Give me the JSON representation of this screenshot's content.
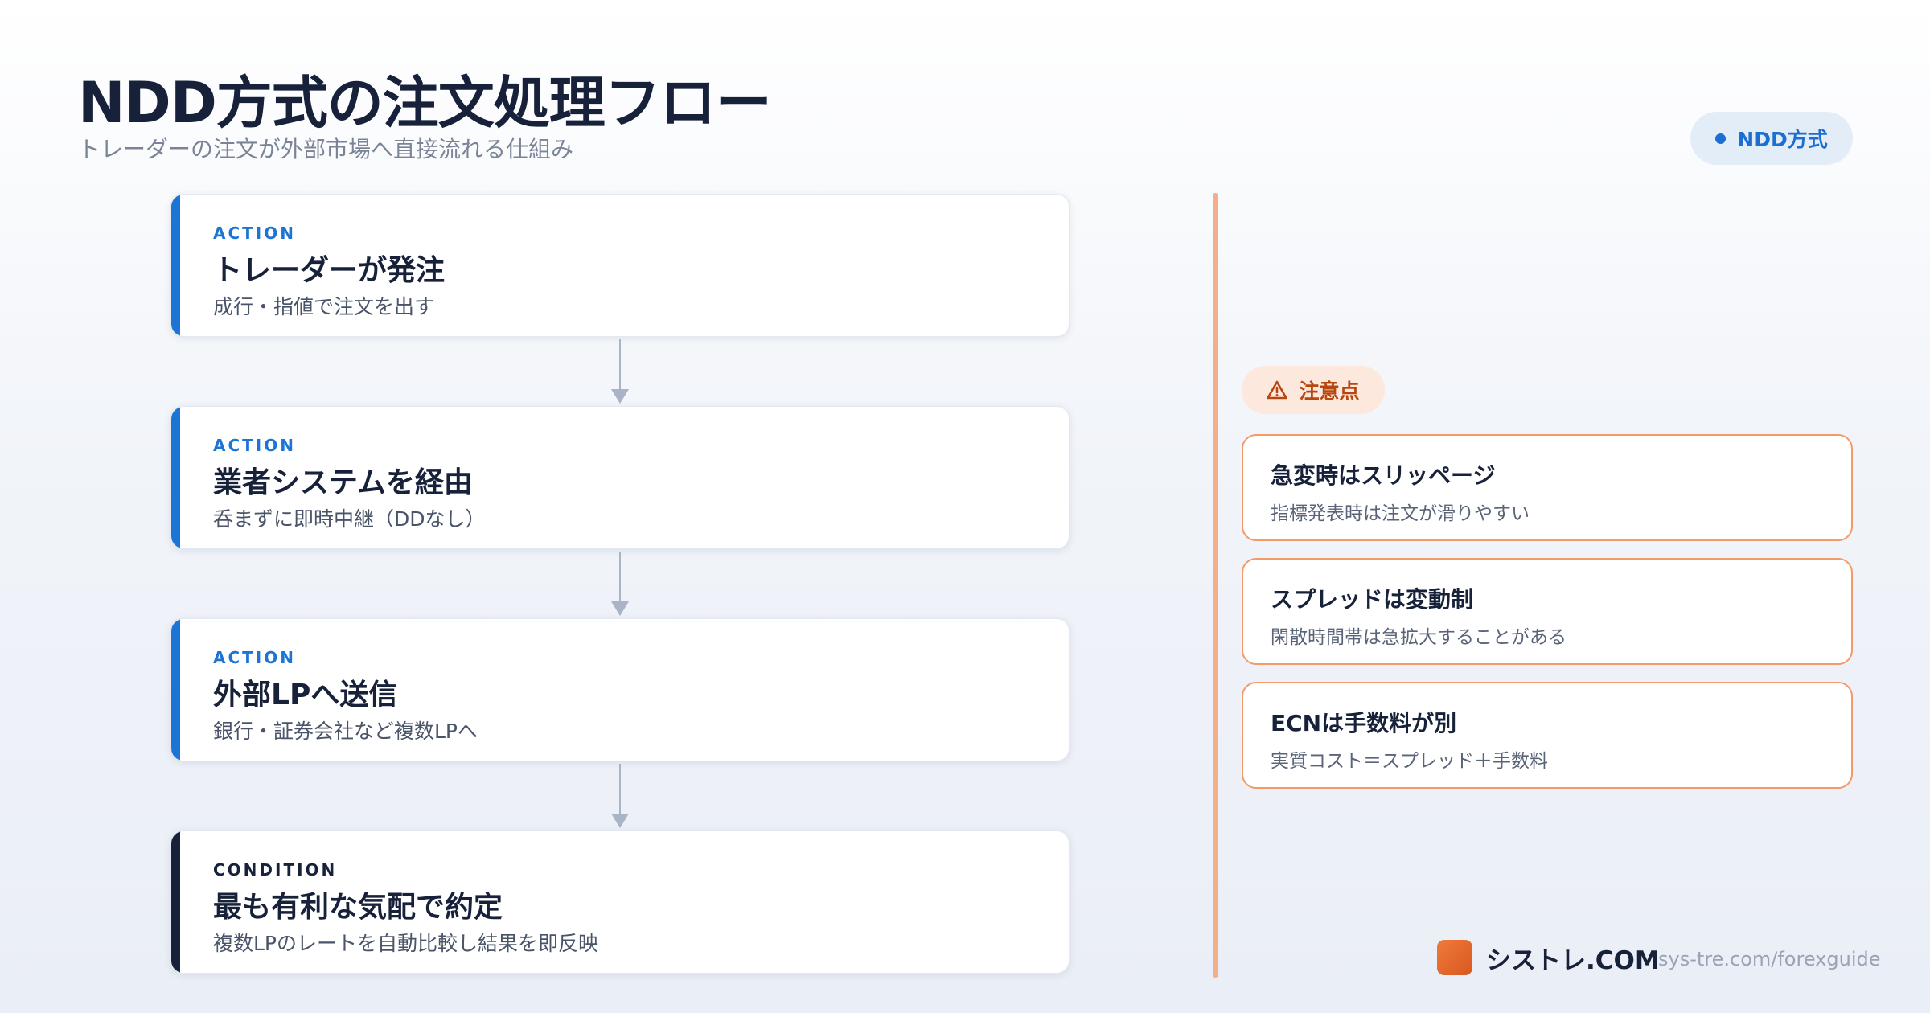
{
  "header": {
    "title": "NDD方式の注文処理フロー",
    "subtitle": "トレーダーの注文が外部市場へ直接流れる仕組み",
    "badge": "NDD方式"
  },
  "flow": [
    {
      "tag": "ACTION",
      "title": "トレーダーが発注",
      "desc": "成行・指値で注文を出す"
    },
    {
      "tag": "ACTION",
      "title": "業者システムを経由",
      "desc": "呑まずに即時中継（DDなし）"
    },
    {
      "tag": "ACTION",
      "title": "外部LPへ送信",
      "desc": "銀行・証券会社など複数LPへ"
    },
    {
      "tag": "CONDITION",
      "title": "最も有利な気配で約定",
      "desc": "複数LPのレートを自動比較し結果を即反映"
    }
  ],
  "cautions": {
    "label": "注意点",
    "items": [
      {
        "title": "急変時はスリッページ",
        "desc": "指標発表時は注文が滑りやすい"
      },
      {
        "title": "スプレッドは変動制",
        "desc": "閑散時間帯は急拡大することがある"
      },
      {
        "title": "ECNは手数料が別",
        "desc": "実質コスト＝スプレッド＋手数料"
      }
    ]
  },
  "footer": {
    "brand": "シストレ.COM",
    "url": "sys-tre.com/forexguide"
  },
  "colors": {
    "action": "#1c74d4",
    "condition": "#17223a",
    "caution": "#f29a6a"
  },
  "icons": {
    "badge": "dot-icon",
    "caution": "warning-triangle-icon",
    "logo": "logo-square-icon"
  }
}
